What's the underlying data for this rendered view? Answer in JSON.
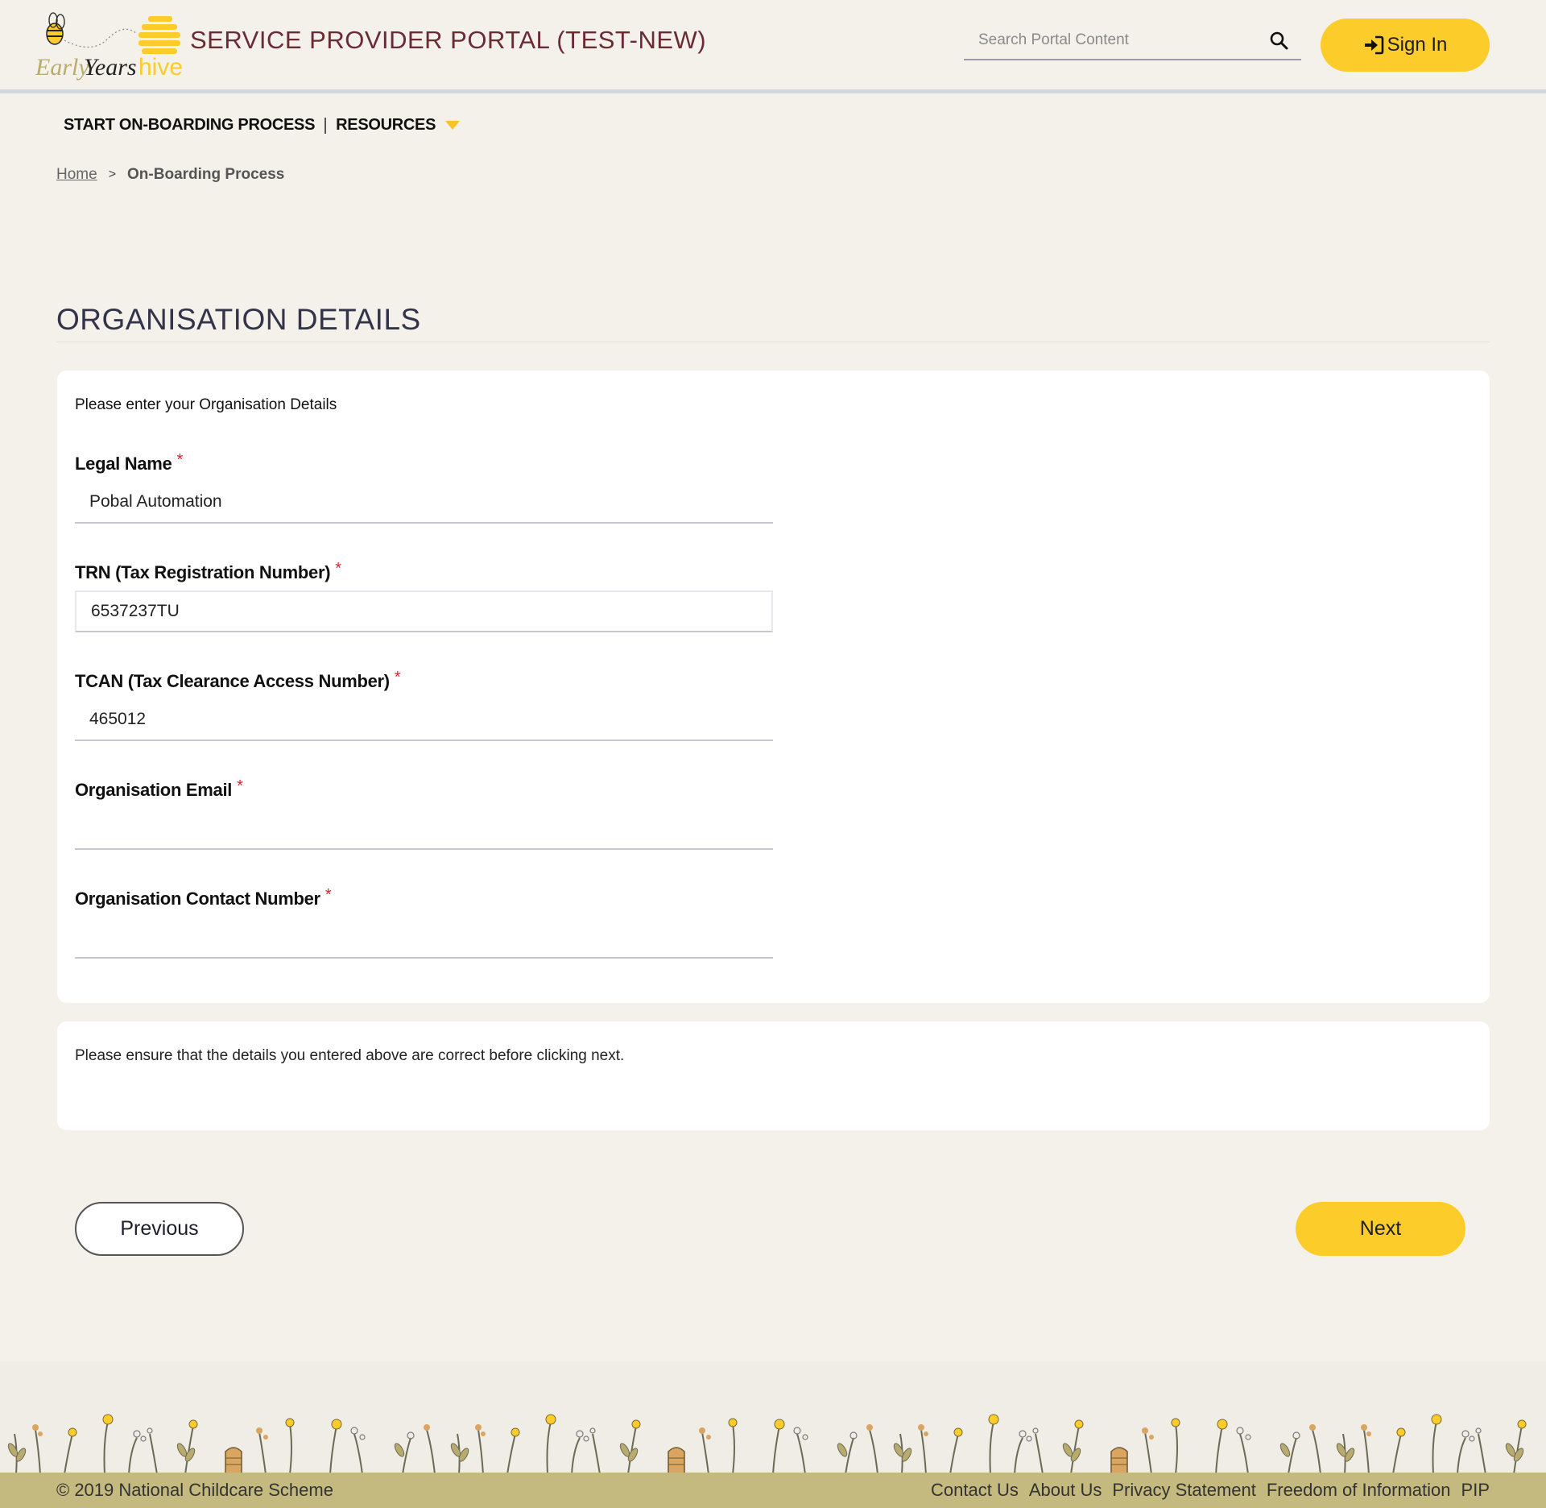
{
  "header": {
    "logo_text_early": "Early",
    "logo_text_years": "Years",
    "logo_text_hive": "hive",
    "portal_title": "SERVICE PROVIDER PORTAL (TEST-NEW)",
    "search_placeholder": "Search Portal Content",
    "sign_in_label": "Sign In"
  },
  "nav": {
    "items": [
      {
        "label": "START ON-BOARDING PROCESS"
      },
      {
        "label": "RESOURCES"
      }
    ]
  },
  "breadcrumb": {
    "home": "Home",
    "separator": ">",
    "current": "On-Boarding Process"
  },
  "page": {
    "section_title": "ORGANISATION DETAILS",
    "intro": "Please enter your Organisation Details",
    "required_marker": "*",
    "fields": [
      {
        "label": "Legal Name",
        "value": "Pobal Automation"
      },
      {
        "label": "TRN (Tax Registration Number)",
        "value": "6537237TU"
      },
      {
        "label": "TCAN (Tax Clearance Access Number)",
        "value": "465012"
      },
      {
        "label": "Organisation Email",
        "value": ""
      },
      {
        "label": "Organisation Contact Number",
        "value": ""
      }
    ],
    "note": "Please ensure that the details you entered above are correct before clicking next."
  },
  "actions": {
    "previous": "Previous",
    "next": "Next"
  },
  "footer": {
    "copyright": "© 2019 National Childcare Scheme",
    "links": [
      "Contact Us",
      "About Us",
      "Privacy Statement",
      "Freedom of Information",
      "PIP"
    ]
  },
  "colors": {
    "accent_yellow": "#fccc2a",
    "title_maroon": "#6b2b33",
    "required_red": "#d9262f",
    "page_bg": "#f3f1ea",
    "footer_bar": "#c4b97e"
  }
}
